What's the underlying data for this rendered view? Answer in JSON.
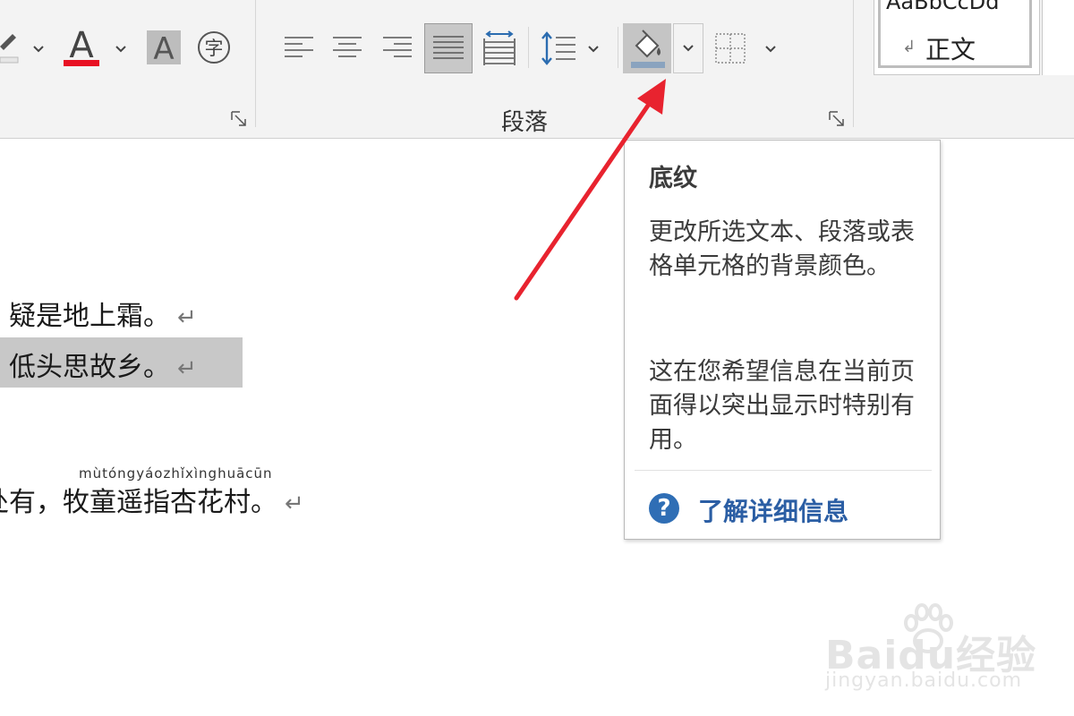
{
  "ribbon": {
    "paragraph_group_label": "段落",
    "style_gallery": {
      "normal_style_name": "正文",
      "normal_style_sample": "AaBbCcDd",
      "paragraph_mark": "↲"
    },
    "buttons": [
      {
        "name": "highlight-color",
        "icon": "highlighter-icon"
      },
      {
        "name": "font-color",
        "icon": "font-color-icon",
        "accent": "#e81123"
      },
      {
        "name": "character-shading",
        "icon": "character-shading-icon"
      },
      {
        "name": "enclose-characters",
        "icon": "enclosed-character-icon",
        "glyph": "字"
      },
      {
        "name": "align-left",
        "icon": "align-left-icon"
      },
      {
        "name": "center",
        "icon": "align-center-icon"
      },
      {
        "name": "align-right",
        "icon": "align-right-icon"
      },
      {
        "name": "justify",
        "icon": "justify-icon",
        "state": "pressed"
      },
      {
        "name": "distributed",
        "icon": "distributed-icon"
      },
      {
        "name": "line-spacing",
        "icon": "line-spacing-icon"
      },
      {
        "name": "shading",
        "icon": "paint-bucket-icon",
        "state": "hover"
      },
      {
        "name": "borders",
        "icon": "borders-icon"
      }
    ]
  },
  "document": {
    "lines": [
      {
        "text": "疑是地上霜。",
        "highlighted": false
      },
      {
        "text": "低头思故乡。",
        "highlighted": true
      },
      {
        "text": "有，牧童遥指杏花村。",
        "highlighted": false
      }
    ],
    "paragraph_mark": "↵",
    "partial_char": "处",
    "pinyin": "mùtóngyáozhǐxìnghuācūn"
  },
  "tooltip": {
    "title": "底纹",
    "description": "更改所选文本、段落或表格单元格的背景颜色。",
    "usage": "这在您希望信息在当前页面得以突出显示时特别有用。",
    "help_link": "了解详细信息",
    "help_icon": "?"
  },
  "annotation": {
    "arrow_color": "#e8232f"
  },
  "watermark": {
    "text": "Baidu经验",
    "subtext": "jingyan.baidu.com"
  }
}
